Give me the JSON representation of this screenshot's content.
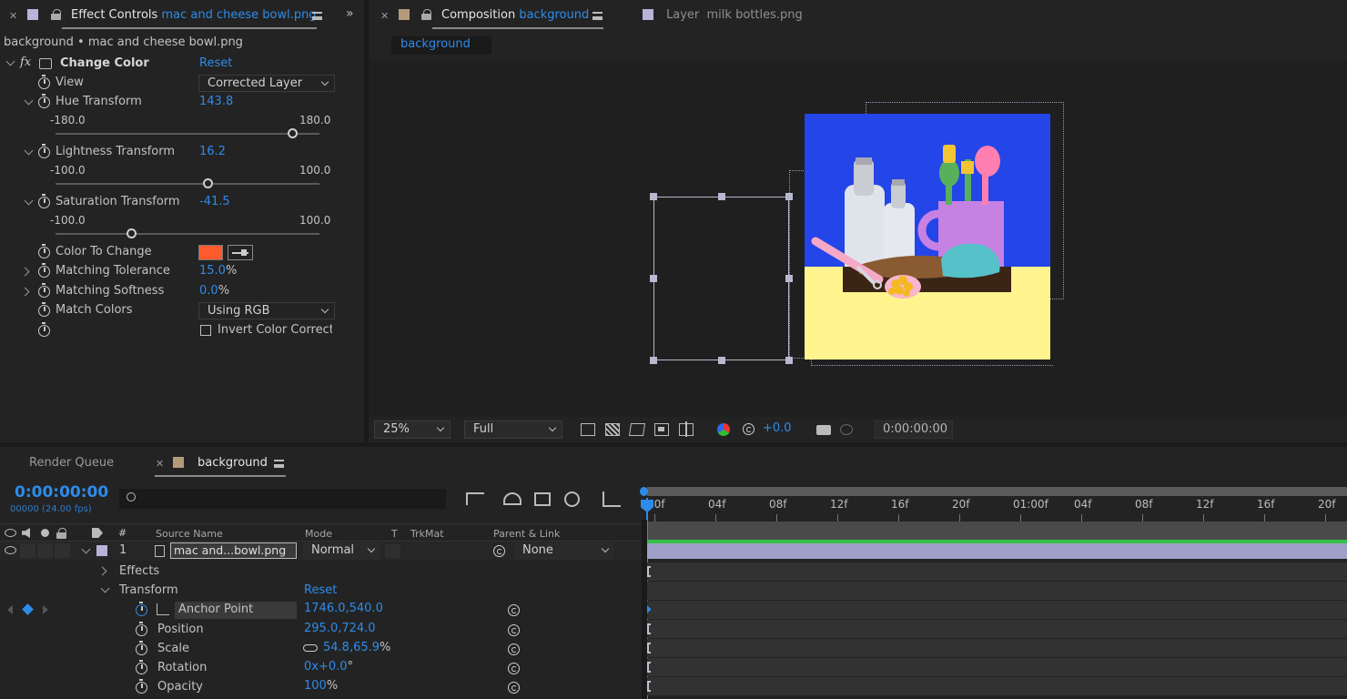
{
  "effect_controls": {
    "tab_title": "Effect Controls",
    "tab_file": "mac and cheese bowl.png",
    "breadcrumb": "background • mac and cheese bowl.png",
    "effect_name": "Change Color",
    "fx": "fx",
    "reset": "Reset",
    "view_label": "View",
    "view_value": "Corrected Layer",
    "hue_label": "Hue Transform",
    "hue_value": "143.8",
    "hue_min": "-180.0",
    "hue_max": "180.0",
    "hue_fraction": 0.9,
    "lightness_label": "Lightness Transform",
    "lightness_value": "16.2",
    "lightness_min": "-100.0",
    "lightness_max": "100.0",
    "lightness_fraction": 0.58,
    "saturation_label": "Saturation Transform",
    "saturation_value": "-41.5",
    "saturation_min": "-100.0",
    "saturation_max": "100.0",
    "saturation_fraction": 0.29,
    "color_label": "Color To Change",
    "color_value": "#ff5a2c",
    "tolerance_label": "Matching Tolerance",
    "tolerance_value": "15.0",
    "softness_label": "Matching Softness",
    "softness_value": "0.0",
    "percent": "%",
    "match_label": "Match Colors",
    "match_value": "Using RGB",
    "invert_label": "Invert Color Correcti"
  },
  "composition": {
    "tab_title": "Composition",
    "tab_name": "background",
    "layer_tab_title": "Layer",
    "layer_tab_name": "milk bottles.png",
    "sub_tab": "background",
    "zoom": "25%",
    "resolution": "Full",
    "exposure": "+0.0",
    "timecode": "0:00:00:00"
  },
  "timeline": {
    "render_queue": "Render Queue",
    "comp_tab": "background",
    "current_time": "0:00:00:00",
    "frame_info": "00000 (24.00 fps)",
    "ruler_ticks": [
      "00f",
      "04f",
      "08f",
      "12f",
      "16f",
      "20f",
      "01:00f",
      "04f",
      "08f",
      "12f",
      "16f",
      "20f"
    ],
    "col_hash": "#",
    "col_source": "Source Name",
    "col_mode": "Mode",
    "col_t": "T",
    "col_trkmat": "TrkMat",
    "col_parent": "Parent & Link",
    "layer_index": "1",
    "layer_name": "mac and...bowl.png",
    "layer_mode": "Normal",
    "layer_parent": "None",
    "effects_label": "Effects",
    "transform_label": "Transform",
    "reset": "Reset",
    "anchor_label": "Anchor Point",
    "anchor_value": "1746.0,540.0",
    "position_label": "Position",
    "position_value": "295.0,724.0",
    "scale_label": "Scale",
    "scale_value": "54.8,65.9",
    "scale_unit": "%",
    "rotation_label": "Rotation",
    "rotation_value": "0x+0.0",
    "rotation_unit": "°",
    "opacity_label": "Opacity",
    "opacity_value": "100",
    "opacity_unit": "%"
  },
  "colors": {
    "accent": "#2d8ceb",
    "layer_label": "#b9b3d9",
    "layer_bar": "#9fa0c8",
    "comp_blue": "#2445e8",
    "comp_yellow": "#fff48e",
    "swatch": "#ff5a2c"
  }
}
